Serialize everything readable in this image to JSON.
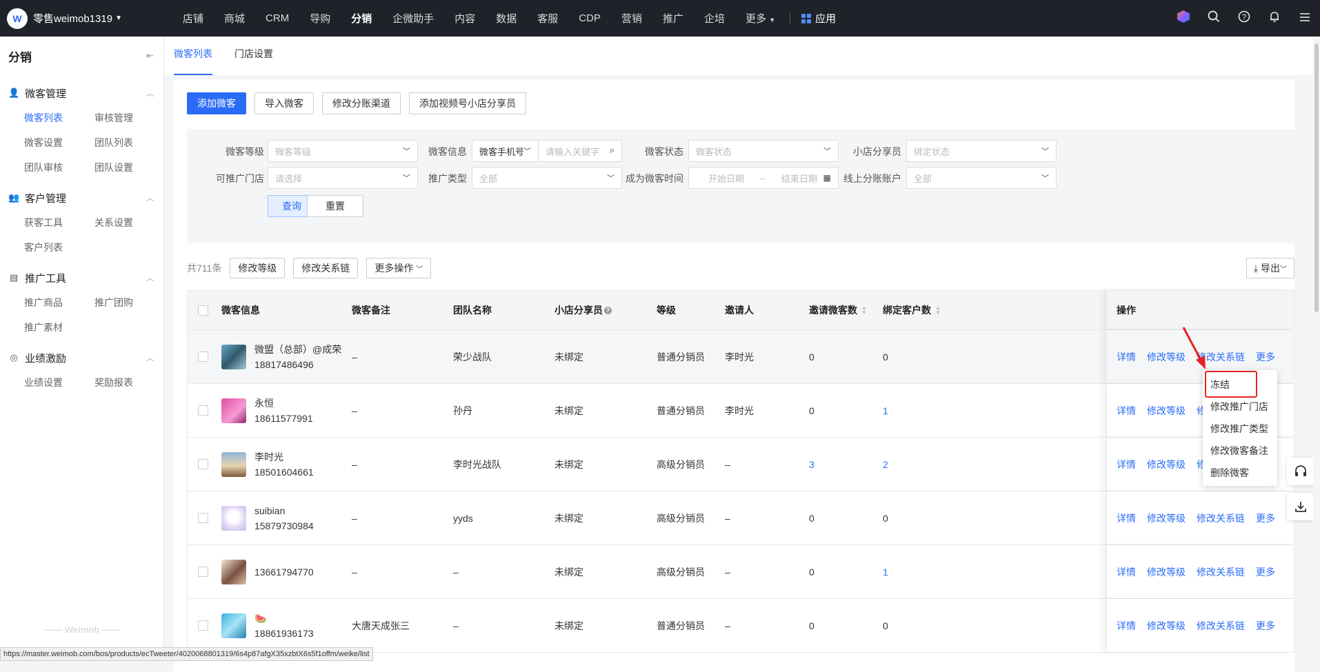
{
  "topbar": {
    "brand": "零售weimob1319",
    "nav": [
      "店铺",
      "商城",
      "CRM",
      "导购",
      "分销",
      "企微助手",
      "内容",
      "数据",
      "客服",
      "CDP",
      "营销",
      "推广",
      "企培",
      "更多"
    ],
    "active_nav": "分销",
    "app_label": "应用"
  },
  "sidebar": {
    "title": "分销",
    "groups": [
      {
        "title": "微客管理",
        "icon": "user-manage-icon",
        "items": [
          "微客列表",
          "审核管理",
          "微客设置",
          "团队列表",
          "团队审核",
          "团队设置"
        ]
      },
      {
        "title": "客户管理",
        "icon": "customer-icon",
        "items": [
          "获客工具",
          "关系设置",
          "客户列表"
        ]
      },
      {
        "title": "推广工具",
        "icon": "promo-tool-icon",
        "items": [
          "推广商品",
          "推广团购",
          "推广素材"
        ]
      },
      {
        "title": "业绩激励",
        "icon": "incentive-icon",
        "items": [
          "业绩设置",
          "奖励报表"
        ]
      }
    ],
    "active_item": "微客列表",
    "footer": "Weimob"
  },
  "tabs": [
    "微客列表",
    "门店设置"
  ],
  "actions": [
    "添加微客",
    "导入微客",
    "修改分账渠道",
    "添加视频号小店分享员"
  ],
  "filters": {
    "level": {
      "label": "微客等级",
      "placeholder": "微客等级"
    },
    "info": {
      "label": "微客信息",
      "type": "微客手机号",
      "placeholder": "请输入关键字"
    },
    "status": {
      "label": "微客状态",
      "placeholder": "微客状态"
    },
    "sharer": {
      "label": "小店分享员",
      "placeholder": "绑定状态"
    },
    "store": {
      "label": "可推广门店",
      "placeholder": "请选择"
    },
    "promo_type": {
      "label": "推广类型",
      "value": "全部"
    },
    "join_time": {
      "label": "成为微客时间",
      "start": "开始日期",
      "sep": "–",
      "end": "结束日期"
    },
    "account": {
      "label": "线上分账账户",
      "value": "全部"
    },
    "query": "查询",
    "reset": "重置"
  },
  "toolbar": {
    "count": "共711条",
    "buttons": [
      "修改等级",
      "修改关系链",
      "更多操作"
    ],
    "export": "导出"
  },
  "table": {
    "headers": [
      "微客信息",
      "微客备注",
      "团队名称",
      "小店分享员",
      "等级",
      "邀请人",
      "邀请微客数",
      "绑定客户数",
      "操作"
    ],
    "rows": [
      {
        "name": "微盟（总部）@成荣",
        "phone": "18817486496",
        "note": "–",
        "team": "荣少战队",
        "sharer": "未绑定",
        "level": "普通分销员",
        "inviter": "李时光",
        "invited": "0",
        "bound": "0"
      },
      {
        "name": "永恒",
        "phone": "18611577991",
        "note": "–",
        "team": "孙丹",
        "sharer": "未绑定",
        "level": "普通分销员",
        "inviter": "李时光",
        "invited": "0",
        "bound": "1"
      },
      {
        "name": "李时光",
        "phone": "18501604661",
        "note": "–",
        "team": "李时光战队",
        "sharer": "未绑定",
        "level": "高级分销员",
        "inviter": "–",
        "invited": "3",
        "bound": "2"
      },
      {
        "name": "suibian",
        "phone": "15879730984",
        "note": "–",
        "team": "yyds",
        "sharer": "未绑定",
        "level": "高级分销员",
        "inviter": "–",
        "invited": "0",
        "bound": "0"
      },
      {
        "name": "",
        "phone": "13661794770",
        "note": "–",
        "team": "–",
        "sharer": "未绑定",
        "level": "高级分销员",
        "inviter": "–",
        "invited": "0",
        "bound": "1"
      },
      {
        "name": "🍉",
        "phone": "18861936173",
        "note": "大唐天成张三",
        "team": "–",
        "sharer": "未绑定",
        "level": "普通分销员",
        "inviter": "–",
        "invited": "0",
        "bound": "0"
      }
    ],
    "ops": [
      "详情",
      "修改等级",
      "修改关系链",
      "更多"
    ],
    "partial_op": "修"
  },
  "dropdown": [
    "冻结",
    "修改推广门店",
    "修改推广类型",
    "修改微客备注",
    "删除微客"
  ],
  "statusbar": "https://master.weimob.com/bos/products/ecTweeter/4020068801319/6s4p87afgX35xzbtX6s5f1offm/weike/list",
  "colors": {
    "accent": "#2a6cf6",
    "topbar": "#1f2329",
    "highlight": "#e52222"
  }
}
